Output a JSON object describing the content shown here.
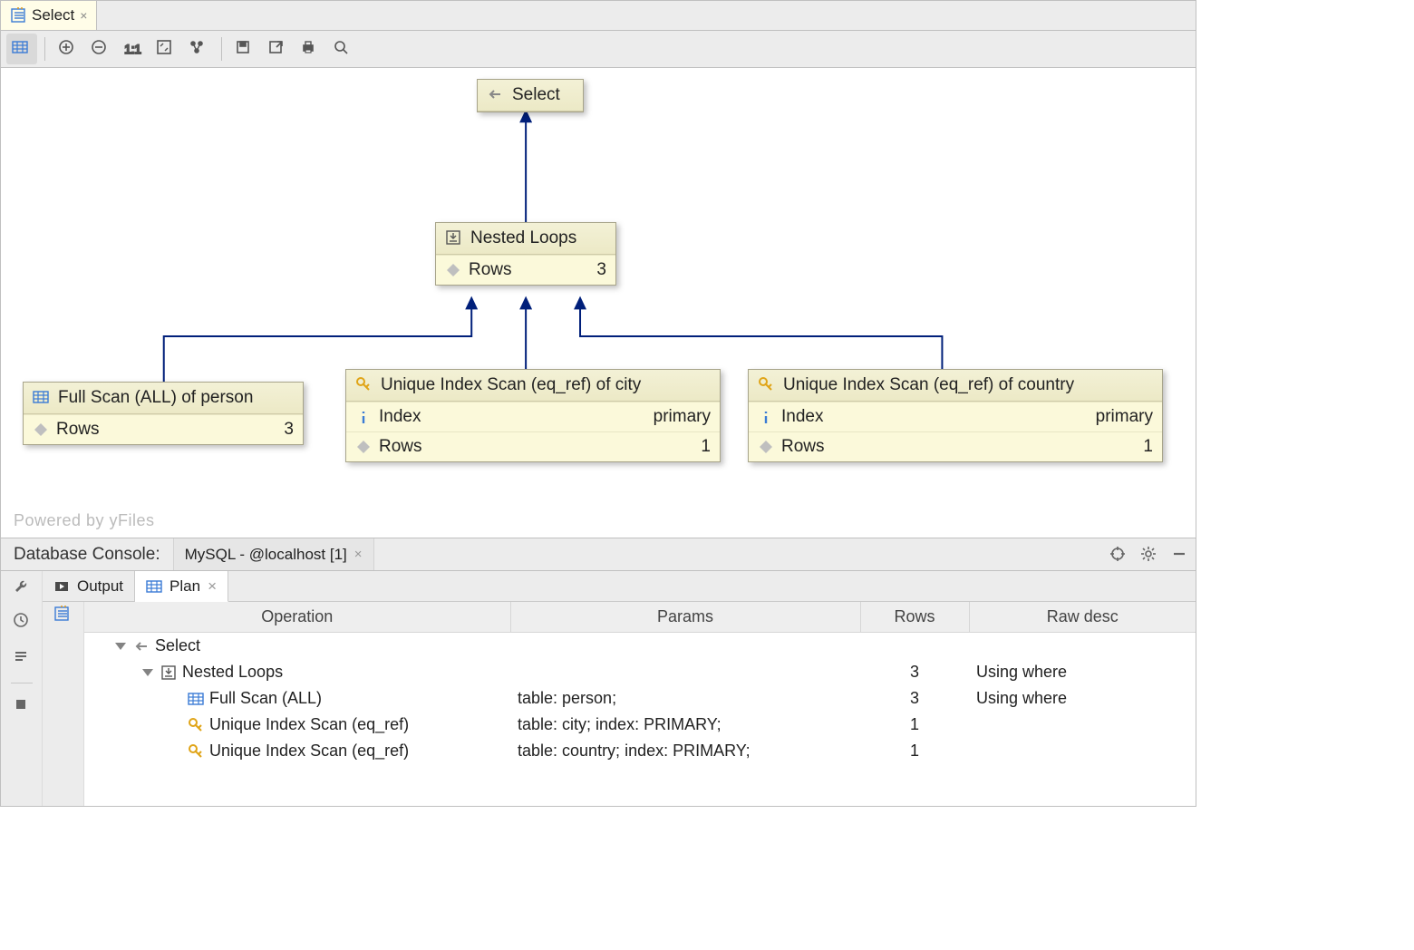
{
  "tab": {
    "label": "Select"
  },
  "canvas": {
    "watermark": "Powered by yFiles",
    "nodes": {
      "select": {
        "title": "Select"
      },
      "nested": {
        "title": "Nested Loops",
        "rows_label": "Rows",
        "rows_value": "3"
      },
      "person": {
        "title": "Full Scan (ALL) of person",
        "rows_label": "Rows",
        "rows_value": "3"
      },
      "city": {
        "title": "Unique Index Scan (eq_ref) of city",
        "index_label": "Index",
        "index_value": "primary",
        "rows_label": "Rows",
        "rows_value": "1"
      },
      "country": {
        "title": "Unique Index Scan (eq_ref) of country",
        "index_label": "Index",
        "index_value": "primary",
        "rows_label": "Rows",
        "rows_value": "1"
      }
    }
  },
  "console": {
    "header_label": "Database Console:",
    "tab_label": "MySQL - @localhost [1]",
    "subtabs": {
      "output": "Output",
      "plan": "Plan"
    },
    "columns": {
      "op": "Operation",
      "params": "Params",
      "rows": "Rows",
      "raw": "Raw desc"
    },
    "rows": [
      {
        "indent": 0,
        "disclose": true,
        "icon": "arrow-left",
        "op": "Select",
        "params": "",
        "rows": "",
        "raw": ""
      },
      {
        "indent": 1,
        "disclose": true,
        "icon": "nested",
        "op": "Nested Loops",
        "params": "",
        "rows": "3",
        "raw": "Using where"
      },
      {
        "indent": 2,
        "disclose": false,
        "icon": "table",
        "op": "Full Scan (ALL)",
        "params": "table: person;",
        "rows": "3",
        "raw": "Using where"
      },
      {
        "indent": 2,
        "disclose": false,
        "icon": "key",
        "op": "Unique Index Scan (eq_ref)",
        "params": "table: city; index: PRIMARY;",
        "rows": "1",
        "raw": ""
      },
      {
        "indent": 2,
        "disclose": false,
        "icon": "key",
        "op": "Unique Index Scan (eq_ref)",
        "params": "table: country; index: PRIMARY;",
        "rows": "1",
        "raw": ""
      }
    ]
  }
}
